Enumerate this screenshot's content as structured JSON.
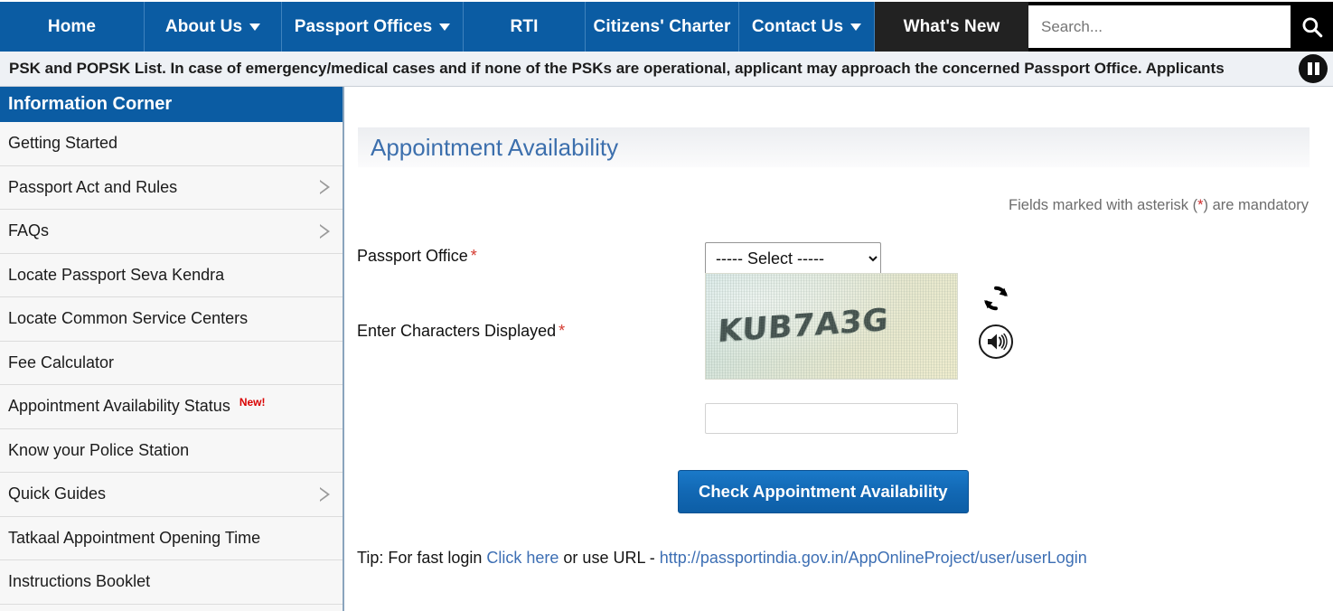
{
  "nav": {
    "items": [
      {
        "label": "Home",
        "has_caret": false,
        "cls": "home"
      },
      {
        "label": "About Us",
        "has_caret": true,
        "cls": "about"
      },
      {
        "label": "Passport Offices",
        "has_caret": true,
        "cls": "offices"
      },
      {
        "label": "RTI",
        "has_caret": false,
        "cls": "rti"
      },
      {
        "label": "Citizens' Charter",
        "has_caret": false,
        "cls": "charter"
      },
      {
        "label": "Contact Us",
        "has_caret": true,
        "cls": "contact"
      },
      {
        "label": "What's New",
        "has_caret": false,
        "cls": "whatsnew"
      }
    ],
    "search_placeholder": "Search...",
    "search_value": "",
    "search_icon": "search-icon",
    "accent_blue": "#0b5ca3",
    "dark": "#222222"
  },
  "ticker": {
    "text": "PSK and POPSK List. In case of emergency/medical cases and if none of the PSKs are operational, applicant may approach the concerned Passport Office. Applicants",
    "pause_icon": "pause-icon"
  },
  "sidebar": {
    "header": "Information Corner",
    "items": [
      {
        "label": "Getting Started",
        "arrow": false,
        "badge": ""
      },
      {
        "label": "Passport Act and Rules",
        "arrow": true,
        "badge": ""
      },
      {
        "label": "FAQs",
        "arrow": true,
        "badge": ""
      },
      {
        "label": "Locate Passport Seva Kendra",
        "arrow": false,
        "badge": ""
      },
      {
        "label": "Locate Common Service Centers",
        "arrow": false,
        "badge": ""
      },
      {
        "label": "Fee Calculator",
        "arrow": false,
        "badge": ""
      },
      {
        "label": "Appointment Availability Status",
        "arrow": false,
        "badge": "New!"
      },
      {
        "label": "Know your Police Station",
        "arrow": false,
        "badge": ""
      },
      {
        "label": "Quick Guides",
        "arrow": true,
        "badge": ""
      },
      {
        "label": "Tatkaal Appointment Opening Time",
        "arrow": false,
        "badge": ""
      },
      {
        "label": "Instructions Booklet",
        "arrow": false,
        "badge": ""
      }
    ]
  },
  "main": {
    "page_title": "Appointment Availability",
    "mandatory_prefix": "Fields marked with asterisk (",
    "mandatory_asterisk": "*",
    "mandatory_suffix": ") are mandatory",
    "passport_office_label": "Passport Office",
    "passport_office_value": "----- Select -----",
    "passport_office_options": [
      "----- Select -----"
    ],
    "captcha_label": "Enter Characters Displayed",
    "captcha_text": "KUB7A3G",
    "captcha_input_value": "",
    "refresh_icon": "refresh-icon",
    "audio_icon": "speaker-icon",
    "submit_label": "Check Appointment Availability",
    "tip_prefix": "Tip: For fast login ",
    "tip_link": "Click here",
    "tip_middle": " or use URL - ",
    "tip_url": "http://passportindia.gov.in/AppOnlineProject/user/userLogin"
  }
}
